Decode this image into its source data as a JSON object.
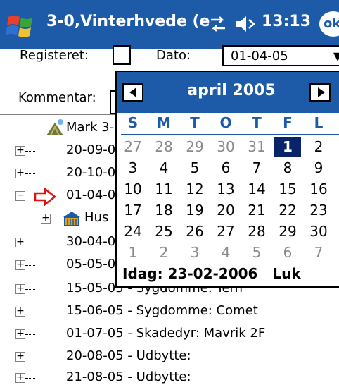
{
  "titlebar": {
    "title": "3-0,Vinterhvede (e",
    "time": "13:13",
    "ok_label": "ok",
    "icons": [
      "windows-start-icon",
      "connectivity-icon",
      "volume-icon"
    ]
  },
  "form": {
    "registeret_label": "Registeret:",
    "dato_label": "Dato:",
    "dato_value": "01-04-05",
    "kommentar_label": "Kommentar:"
  },
  "tree": {
    "items": [
      {
        "text": "Mark 3-"
      },
      {
        "text": "20-09-0"
      },
      {
        "text": "20-10-0"
      },
      {
        "text": "01-04-0"
      },
      {
        "text": "Hus"
      },
      {
        "text": "30-04-0"
      },
      {
        "text": "05-05-0"
      },
      {
        "text": "15-05-05 - Sygdomme: Tern"
      },
      {
        "text": "15-06-05 - Sygdomme: Comet"
      },
      {
        "text": "01-07-05 - Skadedyr: Mavrik 2F"
      },
      {
        "text": "20-08-05 - Udbytte:"
      },
      {
        "text": "21-08-05 - Udbytte:"
      }
    ]
  },
  "calendar": {
    "month_label": "april 2005",
    "weekdays": [
      "S",
      "M",
      "T",
      "O",
      "T",
      "F",
      "L"
    ],
    "weeks": [
      [
        "27",
        "28",
        "29",
        "30",
        "31",
        "1",
        "2"
      ],
      [
        "3",
        "4",
        "5",
        "6",
        "7",
        "8",
        "9"
      ],
      [
        "10",
        "11",
        "12",
        "13",
        "14",
        "15",
        "16"
      ],
      [
        "17",
        "18",
        "19",
        "20",
        "21",
        "22",
        "23"
      ],
      [
        "24",
        "25",
        "26",
        "27",
        "28",
        "29",
        "30"
      ],
      [
        "1",
        "2",
        "3",
        "4",
        "5",
        "6",
        "7"
      ]
    ],
    "today_text": "Idag: 23-02-2006",
    "close_label": "Luk"
  }
}
